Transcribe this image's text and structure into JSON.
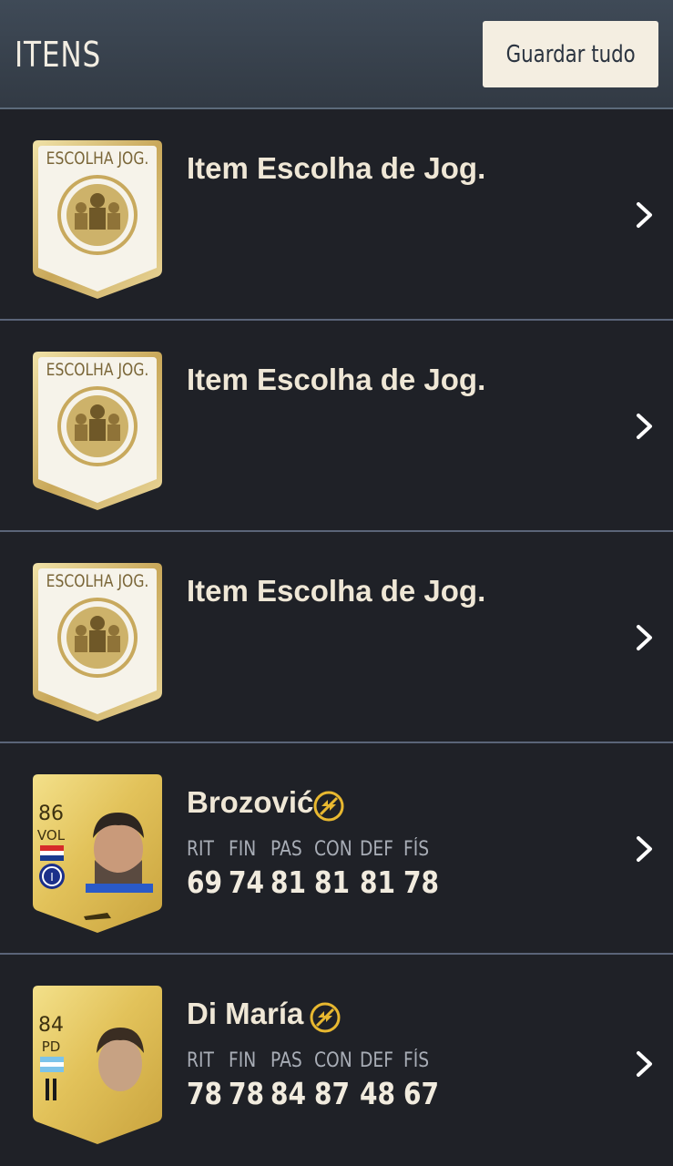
{
  "header": {
    "title": "ITENS",
    "save_label": "Guardar tudo"
  },
  "items": [
    {
      "type": "pick",
      "card_label": "ESCOLHA JOG.",
      "title": "Item Escolha de Jog."
    },
    {
      "type": "pick",
      "card_label": "ESCOLHA JOG.",
      "title": "Item Escolha de Jog."
    },
    {
      "type": "pick",
      "card_label": "ESCOLHA JOG.",
      "title": "Item Escolha de Jog."
    },
    {
      "type": "player",
      "name": "Brozović",
      "rating": "86",
      "position": "VOL",
      "stat_labels": [
        "RIT",
        "FIN",
        "PAS",
        "CON",
        "DEF",
        "FÍS"
      ],
      "stat_values": [
        "69",
        "74",
        "81",
        "81",
        "81",
        "78"
      ]
    },
    {
      "type": "player",
      "name": "Di María",
      "rating": "84",
      "position": "PD",
      "stat_labels": [
        "RIT",
        "FIN",
        "PAS",
        "CON",
        "DEF",
        "FÍS"
      ],
      "stat_values": [
        "78",
        "78",
        "84",
        "87",
        "48",
        "67"
      ]
    }
  ],
  "colors": {
    "header_bg": "#3a4450",
    "body_bg": "#1f2127",
    "gold": "#d7c07a",
    "chem_accent": "#e8b830"
  }
}
